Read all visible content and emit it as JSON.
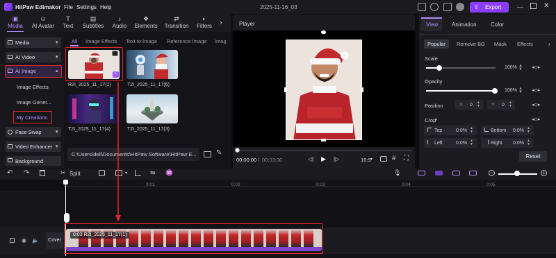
{
  "app": {
    "name": "HitPaw Edimakor",
    "menu": [
      "File",
      "Settings",
      "Help"
    ],
    "project": "2025-11-16_03",
    "export_label": "Export"
  },
  "toolbar": [
    {
      "label": "Media",
      "icon": "media-icon"
    },
    {
      "label": "AI Avatar",
      "icon": "ai-avatar-icon"
    },
    {
      "label": "Text",
      "icon": "text-icon"
    },
    {
      "label": "Subtitles",
      "icon": "subtitles-icon"
    },
    {
      "label": "Audio",
      "icon": "audio-icon"
    },
    {
      "label": "Elements",
      "icon": "elements-icon"
    },
    {
      "label": "Transition",
      "icon": "transition-icon"
    },
    {
      "label": "Filters",
      "icon": "filters-icon"
    }
  ],
  "leftnav": {
    "media": "Media",
    "ai_video": "AI Video",
    "ai_image": "AI Image",
    "sub_items": [
      "Image Effects",
      "Image Gener...",
      "My Creations"
    ],
    "face_swap": "Face Swap",
    "video_enhancer": "Video Enhancer",
    "background": "Background"
  },
  "media": {
    "tabs": [
      "All",
      "Image Effects",
      "Text to Image",
      "Reference Image",
      "Imag"
    ],
    "items": [
      {
        "label": "R2I_2025_11_17(1)"
      },
      {
        "label": "T2I_2025_11_17(6)"
      },
      {
        "label": "T2I_2025_11_17(4)"
      },
      {
        "label": "T2I_2025_11_17(3)"
      }
    ],
    "path": "C:\\Users\\dell\\Documents\\HitPaw Software\\HitPaw E..."
  },
  "player": {
    "title": "Player",
    "time_current": "00:00:00",
    "time_total": "00:03:00",
    "aspect": "16:9"
  },
  "props": {
    "tabs": [
      "View",
      "Animation",
      "Color"
    ],
    "chips": [
      "Popular",
      "Remove BG",
      "Mask",
      "Effects"
    ],
    "scale_label": "Scale",
    "scale_value": "100%",
    "opacity_label": "Opacity",
    "opacity_value": "100%",
    "position_label": "Position",
    "pos_x_label": "X",
    "pos_x": "0",
    "pos_y_label": "Y",
    "pos_y": "0",
    "crop_label": "Crop",
    "crop_top_label": "Top",
    "crop_top": "0.0%",
    "crop_bottom_label": "Bottom",
    "crop_bottom": "0.0%",
    "crop_left_label": "Left",
    "crop_left": "0.0%",
    "crop_right_label": "Right",
    "crop_right": "0.0%",
    "reset_label": "Reset"
  },
  "timeline": {
    "split_label": "Split",
    "ticks": [
      "0:01",
      "0:02",
      "0:03",
      "0:04",
      "0:05"
    ],
    "cover_label": "Cover",
    "clip_label": "0:03 R2I_2025_11_17(1)"
  }
}
